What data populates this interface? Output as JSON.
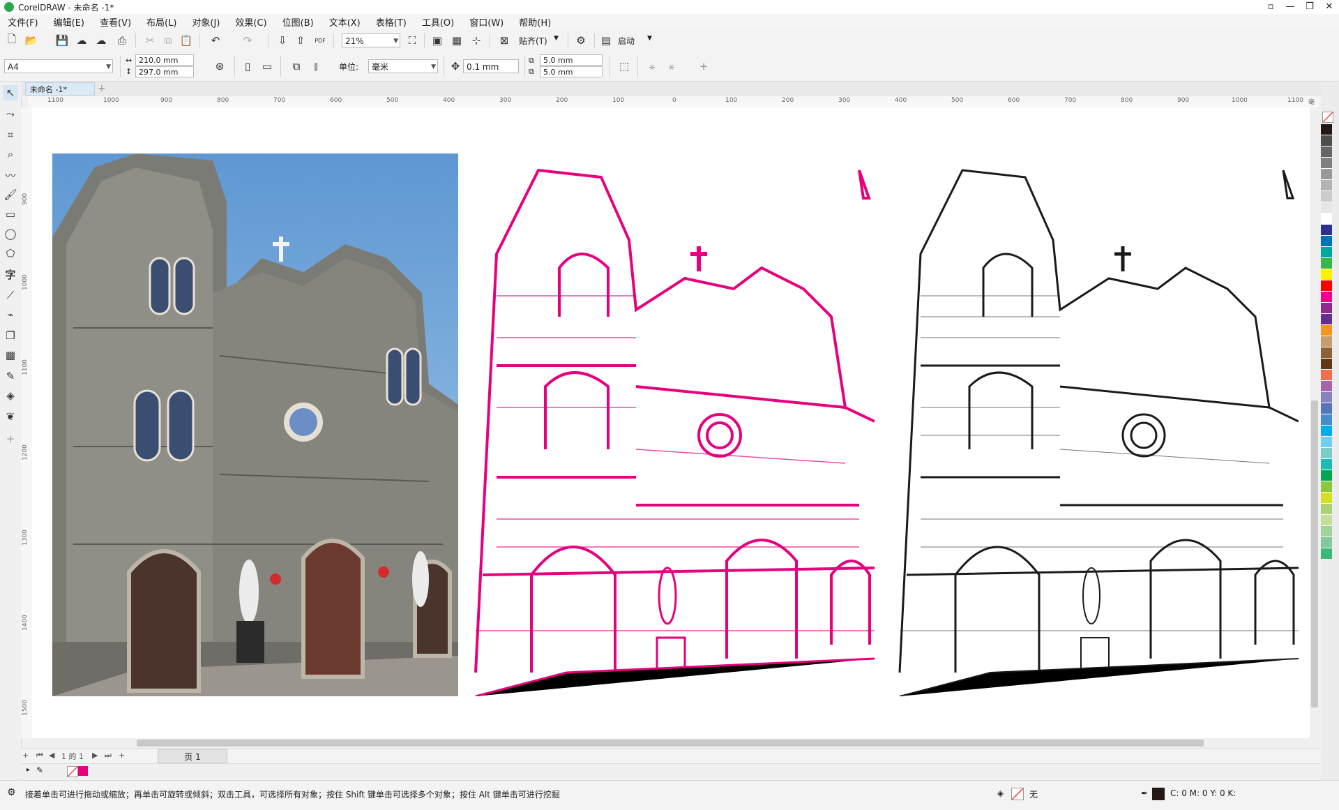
{
  "window": {
    "title": "CorelDRAW - 未命名 -1*"
  },
  "menu": [
    "文件(F)",
    "编辑(E)",
    "查看(V)",
    "布局(L)",
    "对象(J)",
    "效果(C)",
    "位图(B)",
    "文本(X)",
    "表格(T)",
    "工具(O)",
    "窗口(W)",
    "帮助(H)"
  ],
  "toolbar": {
    "zoom_value": "21%",
    "snap_label": "贴齐(T)",
    "launch_label": "启动",
    "pdf_label": "PDF"
  },
  "property_bar": {
    "page_size": "A4",
    "width": "210.0 mm",
    "height": "297.0 mm",
    "units_label": "单位:",
    "units_value": "毫米",
    "nudge": "0.1 mm",
    "dup_x": "5.0 mm",
    "dup_y": "5.0 mm"
  },
  "doc_tab": "未命名 -1*",
  "ruler": {
    "h_ticks": [
      "1100",
      "1000",
      "900",
      "800",
      "700",
      "600",
      "500",
      "400",
      "300",
      "200",
      "100",
      "0",
      "100",
      "200",
      "300",
      "400",
      "500",
      "600",
      "700",
      "800",
      "900",
      "1000",
      "1100"
    ],
    "h_unit": "毫米",
    "v_ticks": [
      "900",
      "1000",
      "1100",
      "1200",
      "1300",
      "1400",
      "1500"
    ]
  },
  "page_nav": {
    "of_text": "1 的 1",
    "page_tab": "页 1"
  },
  "status": {
    "hint": "接着单击可进行拖动或缩放；再单击可旋转或倾斜；双击工具，可选择所有对象；按住 Shift 键单击可选择多个对象；按住 Alt 键单击可进行挖掘",
    "fill_none": "无",
    "color_values": "C: 0 M: 0 Y: 0 K:"
  },
  "palette": [
    "#231815",
    "#4d4d4d",
    "#666666",
    "#808080",
    "#999999",
    "#b3b3b3",
    "#cccccc",
    "#e6e6e6",
    "#ffffff",
    "#2e3192",
    "#0071bc",
    "#00a99d",
    "#39b54a",
    "#fff200",
    "#ff0000",
    "#ec008c",
    "#92278f",
    "#662d91",
    "#f7941d",
    "#c69c6d",
    "#8c6239",
    "#603813",
    "#f26c4f",
    "#a864a8",
    "#8781bd",
    "#5674b9",
    "#448ccb",
    "#00aeef",
    "#6dcff6",
    "#7accc8",
    "#1cbbb4",
    "#00a651",
    "#8dc63f",
    "#d7df23",
    "#abd373",
    "#c4df9b",
    "#a3d39c",
    "#82ca9c",
    "#3cb878"
  ],
  "colors": {
    "magenta": "#e6007e",
    "sky": "#6a9fd4",
    "stone": "#8a8a84"
  }
}
